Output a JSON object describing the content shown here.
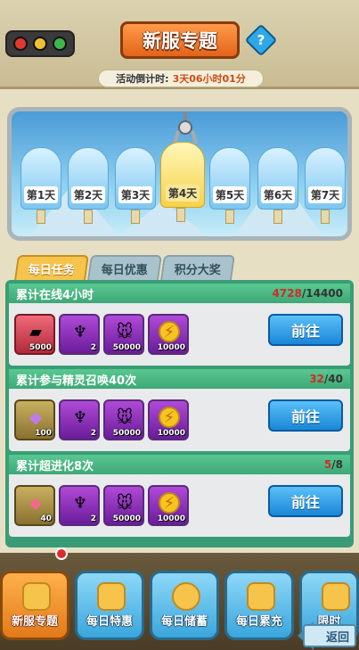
{
  "header": {
    "title": "新服专题",
    "help_icon": "?",
    "countdown_label": "活动倒计时:",
    "countdown_value": "3天06小时01分"
  },
  "days": [
    {
      "label": "第1天",
      "active": false
    },
    {
      "label": "第2天",
      "active": false
    },
    {
      "label": "第3天",
      "active": false
    },
    {
      "label": "第4天",
      "active": true
    },
    {
      "label": "第5天",
      "active": false
    },
    {
      "label": "第6天",
      "active": false
    },
    {
      "label": "第7天",
      "active": false
    }
  ],
  "tabs": [
    {
      "label": "每日任务",
      "active": true
    },
    {
      "label": "每日优惠",
      "active": false
    },
    {
      "label": "积分大奖",
      "active": false
    }
  ],
  "tasks": [
    {
      "title": "累计在线4小时",
      "current": "4728",
      "total": "/14400",
      "button": "前往",
      "rewards": [
        {
          "icon": "red-card-icon",
          "qty": "5000"
        },
        {
          "icon": "trophy-badge-icon",
          "qty": "2"
        },
        {
          "icon": "mouse-pet-icon",
          "qty": "50000"
        },
        {
          "icon": "gold-coin-icon",
          "qty": "10000"
        }
      ]
    },
    {
      "title": "累计参与精灵召唤40次",
      "current": "32",
      "total": "/40",
      "button": "前往",
      "rewards": [
        {
          "icon": "purple-crystal-icon",
          "qty": "100"
        },
        {
          "icon": "trophy-badge-icon",
          "qty": "2"
        },
        {
          "icon": "mouse-pet-icon",
          "qty": "50000"
        },
        {
          "icon": "gold-coin-icon",
          "qty": "10000"
        }
      ]
    },
    {
      "title": "累计超进化8次",
      "current": "5",
      "total": "/8",
      "button": "前往",
      "rewards": [
        {
          "icon": "red-gem-icon",
          "qty": "40"
        },
        {
          "icon": "trophy-badge-icon",
          "qty": "2"
        },
        {
          "icon": "mouse-pet-icon",
          "qty": "50000"
        },
        {
          "icon": "gold-coin-icon",
          "qty": "10000"
        }
      ]
    }
  ],
  "bottom_nav": [
    {
      "label": "新服专题",
      "active": true
    },
    {
      "label": "每日特惠",
      "active": false
    },
    {
      "label": "每日储蓄",
      "active": false
    },
    {
      "label": "每日累充",
      "active": false
    },
    {
      "label": "限时",
      "active": false
    }
  ],
  "back_label": "返回"
}
